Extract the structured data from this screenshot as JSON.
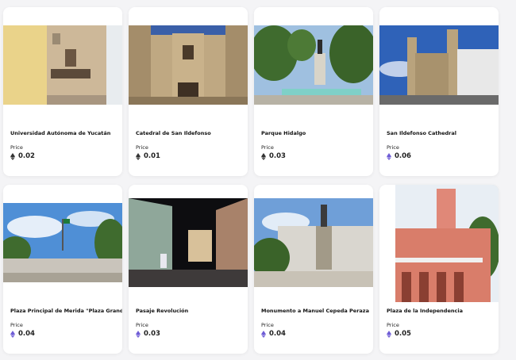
{
  "colors": {
    "eth_dark": "#333333",
    "eth_purple": "#6e5cd6"
  },
  "listings": [
    {
      "title": "Universidad Autónoma de Yucatán",
      "price_label": "Price",
      "price": "0.02",
      "eth_color": "#333333"
    },
    {
      "title": "Catedral de San Ildefonso",
      "price_label": "Price",
      "price": "0.01",
      "eth_color": "#333333"
    },
    {
      "title": "Parque Hidalgo",
      "price_label": "Price",
      "price": "0.03",
      "eth_color": "#333333"
    },
    {
      "title": "San Ildefonso Cathedral",
      "price_label": "Price",
      "price": "0.06",
      "eth_color": "#6e5cd6"
    },
    {
      "title": "Plaza Principal de Merida \"Plaza Grande\"",
      "price_label": "Price",
      "price": "0.04",
      "eth_color": "#6e5cd6"
    },
    {
      "title": "Pasaje Revolución",
      "price_label": "Price",
      "price": "0.03",
      "eth_color": "#6e5cd6"
    },
    {
      "title": "Monumento a Manuel Cepeda Peraza",
      "price_label": "Price",
      "price": "0.04",
      "eth_color": "#6e5cd6"
    },
    {
      "title": "Plaza de la Independencia",
      "price_label": "Price",
      "price": "0.05",
      "eth_color": "#6e5cd6"
    }
  ]
}
